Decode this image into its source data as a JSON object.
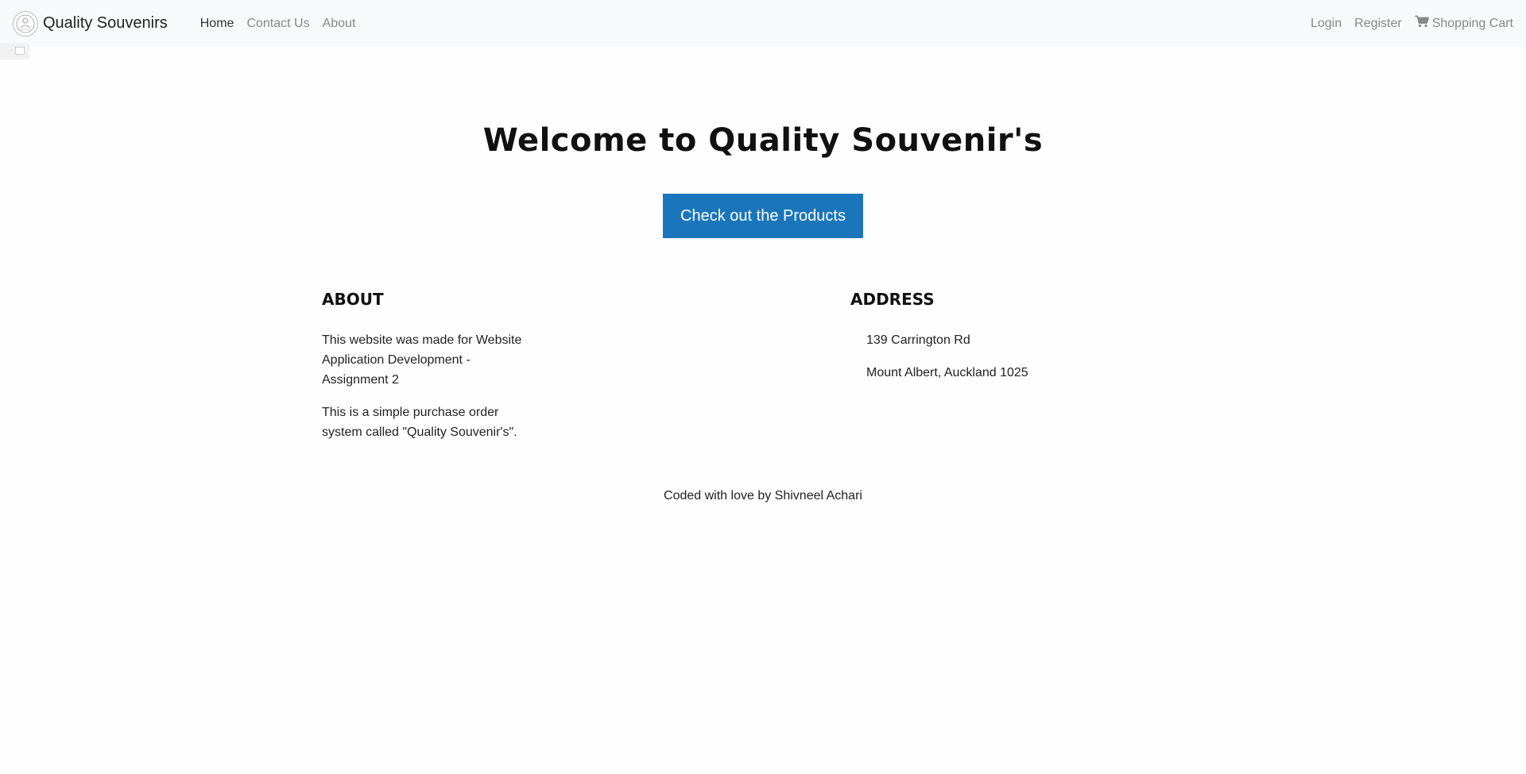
{
  "navbar": {
    "brand_name": "Quality Souvenirs",
    "links_left": [
      {
        "label": "Home",
        "active": true
      },
      {
        "label": "Contact Us",
        "active": false
      },
      {
        "label": "About",
        "active": false
      }
    ],
    "links_right": [
      {
        "label": "Login"
      },
      {
        "label": "Register"
      },
      {
        "label": "Shopping Cart",
        "icon": "shopping-cart-icon"
      }
    ]
  },
  "hero": {
    "title": "Welcome to Quality Souvenir's",
    "cta_label": "Check out the Products"
  },
  "about": {
    "heading": "ABOUT",
    "paragraphs": [
      "This website was made for Website Application Development - Assignment 2",
      "This is a simple purchase order system called \"Quality Souvenir's\"."
    ]
  },
  "address": {
    "heading": "ADDRESS",
    "lines": [
      "139 Carrington Rd",
      "Mount Albert, Auckland 1025"
    ]
  },
  "footer": {
    "text": "Coded with love by Shivneel Achari"
  },
  "colors": {
    "navbar_bg": "#f8f9fa",
    "primary_button": "#1b75bb",
    "nav_link": "#888888",
    "nav_link_active": "#333333"
  }
}
